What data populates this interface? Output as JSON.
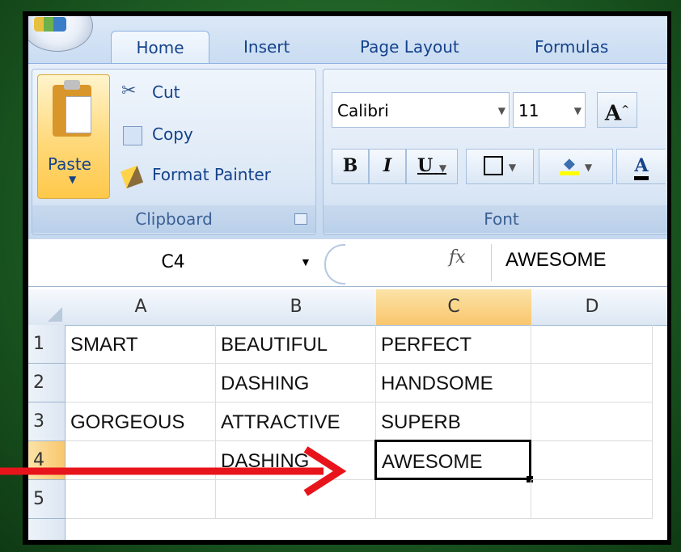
{
  "ribbon": {
    "tabs": [
      "Home",
      "Insert",
      "Page Layout",
      "Formulas"
    ],
    "clipboard": {
      "paste_label": "Paste",
      "cut_label": "Cut",
      "copy_label": "Copy",
      "format_painter_label": "Format Painter",
      "group_label": "Clipboard"
    },
    "font": {
      "font_name": "Calibri",
      "font_size": "11",
      "group_label": "Font",
      "bold_label": "B",
      "italic_label": "I",
      "underline_label": "U",
      "grow_label": "A",
      "color_label": "A"
    }
  },
  "formula_bar": {
    "name_box": "C4",
    "fx_label": "fx",
    "value": "AWESOME"
  },
  "sheet": {
    "columns": [
      "A",
      "B",
      "C",
      "D"
    ],
    "rows": [
      {
        "num": "1",
        "cells": [
          "SMART",
          "BEAUTIFUL",
          "PERFECT",
          ""
        ]
      },
      {
        "num": "2",
        "cells": [
          "",
          "DASHING",
          "HANDSOME",
          ""
        ]
      },
      {
        "num": "3",
        "cells": [
          "GORGEOUS",
          "ATTRACTIVE",
          "SUPERB",
          ""
        ]
      },
      {
        "num": "4",
        "cells": [
          "",
          "DASHING",
          "AWESOME",
          ""
        ]
      },
      {
        "num": "5",
        "cells": [
          "",
          "",
          "",
          ""
        ]
      }
    ],
    "active_cell": "C4"
  },
  "colors": {
    "arrow": "#e8141b",
    "selected_header": "#f9c66d",
    "ribbon_text": "#15428b"
  }
}
